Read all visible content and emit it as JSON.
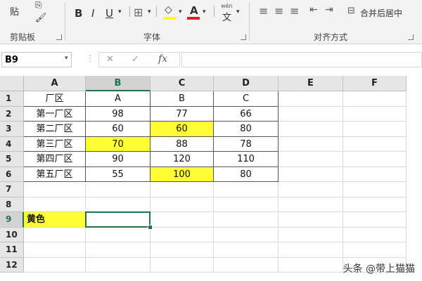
{
  "ribbon": {
    "clipboard": {
      "paste_label": "贴",
      "label": "剪贴板"
    },
    "font": {
      "bold": "B",
      "italic": "I",
      "underline": "U",
      "font_color_glyph": "A",
      "wen_glyph": "wén",
      "wen_char": "文",
      "label": "字体"
    },
    "alignment": {
      "merge_label": "合并后居中",
      "label": "对齐方式"
    }
  },
  "formula_bar": {
    "name_box": "B9",
    "cancel": "✕",
    "confirm": "✓",
    "fx": "fx",
    "content": ""
  },
  "sheet": {
    "columns": [
      "A",
      "B",
      "C",
      "D",
      "E",
      "F"
    ],
    "rows": [
      "1",
      "2",
      "3",
      "4",
      "5",
      "6",
      "7",
      "8",
      "9",
      "10",
      "11",
      "12"
    ],
    "table": [
      [
        "厂区",
        "A",
        "B",
        "C"
      ],
      [
        "第一厂区",
        "98",
        "77",
        "66"
      ],
      [
        "第二厂区",
        "60",
        "60",
        "80"
      ],
      [
        "第三厂区",
        "70",
        "88",
        "78"
      ],
      [
        "第四厂区",
        "90",
        "120",
        "110"
      ],
      [
        "第五厂区",
        "55",
        "100",
        "80"
      ]
    ],
    "label_cell": "黄色",
    "highlight_color": "#ffff33",
    "selected_cell": "B9"
  },
  "watermark": "头条 @带上猫猫"
}
